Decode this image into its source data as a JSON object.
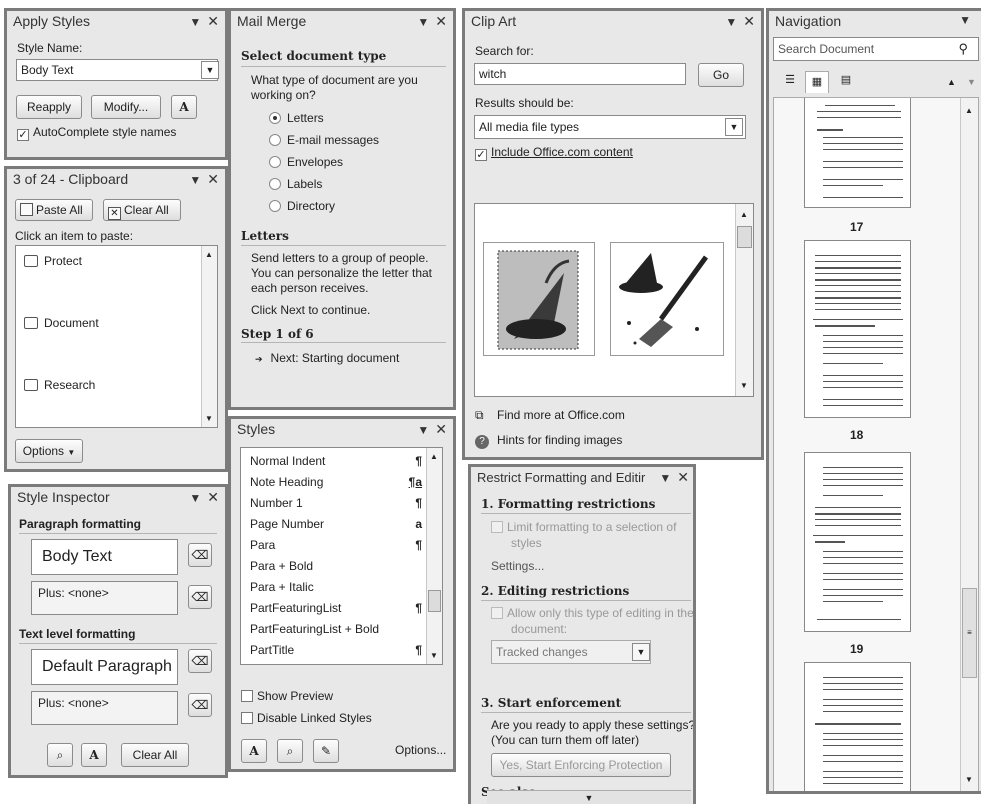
{
  "apply_styles": {
    "title": "Apply Styles",
    "style_name_label": "Style Name:",
    "style_name_value": "Body Text",
    "reapply": "Reapply",
    "modify": "Modify...",
    "styles_icon": "A",
    "autocomplete": "AutoComplete style names"
  },
  "clipboard": {
    "title": "3 of 24 - Clipboard",
    "paste_all": "Paste All",
    "clear_all": "Clear All",
    "instruction": "Click an item to paste:",
    "items": [
      "Protect",
      "Document",
      "Research"
    ],
    "options": "Options"
  },
  "style_inspector": {
    "title": "Style Inspector",
    "paragraph_heading": "Paragraph formatting",
    "paragraph_style": "Body Text",
    "paragraph_plus": "Plus: <none>",
    "text_heading": "Text level formatting",
    "text_style": "Default Paragraph",
    "text_plus": "Plus: <none>",
    "clear_all": "Clear All"
  },
  "mail_merge": {
    "title": "Mail Merge",
    "select_heading": "Select document type",
    "question_line1": "What type of document are you",
    "question_line2": "working on?",
    "options": [
      "Letters",
      "E-mail messages",
      "Envelopes",
      "Labels",
      "Directory"
    ],
    "selected": "Letters",
    "letters_heading": "Letters",
    "desc_line1": "Send letters to a group of people.",
    "desc_line2": "You can personalize the letter that",
    "desc_line3": "each person receives.",
    "click_next": "Click Next to continue.",
    "step": "Step 1 of 6",
    "next": "Next: Starting document"
  },
  "styles": {
    "title": "Styles",
    "items": [
      {
        "name": "Normal Indent",
        "mark": "¶"
      },
      {
        "name": "Note Heading",
        "mark": "¶a"
      },
      {
        "name": "Number 1",
        "mark": "¶"
      },
      {
        "name": "Page Number",
        "mark": "a"
      },
      {
        "name": "Para",
        "mark": "¶"
      },
      {
        "name": "Para + Bold",
        "mark": ""
      },
      {
        "name": "Para + Italic",
        "mark": ""
      },
      {
        "name": "PartFeaturingList",
        "mark": "¶"
      },
      {
        "name": "PartFeaturingList + Bold",
        "mark": ""
      },
      {
        "name": "PartTitle",
        "mark": "¶"
      }
    ],
    "show_preview": "Show Preview",
    "disable_linked": "Disable Linked Styles",
    "options": "Options..."
  },
  "clip_art": {
    "title": "Clip Art",
    "search_label": "Search for:",
    "search_value": "witch",
    "go": "Go",
    "results_label": "Results should be:",
    "results_value": "All media file types",
    "include_office": "Include Office.com content",
    "find_more": "Find more at Office.com",
    "hints": "Hints for finding images"
  },
  "restrict": {
    "title": "Restrict Formatting and Editir",
    "formatting_heading": "1. Formatting restrictions",
    "limit_line1": "Limit formatting to a selection of",
    "limit_line2": "styles",
    "settings": "Settings...",
    "editing_heading": "2. Editing restrictions",
    "allow_line1": "Allow only this type of editing in the",
    "allow_line2": "document:",
    "editing_value": "Tracked changes",
    "enforcement_heading": "3. Start enforcement",
    "question_line1": "Are you ready to apply these settings?",
    "question_line2": "(You can turn them off later)",
    "enforce_button": "Yes, Start Enforcing Protection",
    "see_also": "See also"
  },
  "navigation": {
    "title": "Navigation",
    "search_placeholder": "Search Document",
    "page_numbers": [
      "17",
      "18",
      "19"
    ]
  }
}
